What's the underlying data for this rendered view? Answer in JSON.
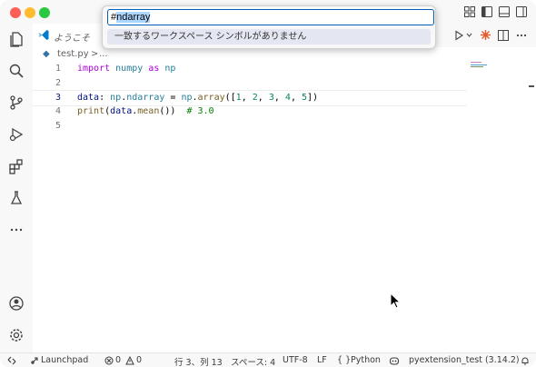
{
  "window": {
    "title_icons": [
      "layout-icon",
      "toggle-primary-sidebar-icon",
      "toggle-panel-icon",
      "toggle-secondary-sidebar-icon"
    ]
  },
  "tab": {
    "label": "ようこそ"
  },
  "breadcrumb": {
    "file": "test.py",
    "separator": ">",
    "more": "..."
  },
  "quick_input": {
    "value_prefix": "#",
    "value_selected": "ndarray",
    "no_results": "一致するワークスペース シンボルがありません"
  },
  "editor": {
    "lines": [
      {
        "num": "1"
      },
      {
        "num": "2"
      },
      {
        "num": "3"
      },
      {
        "num": "4"
      },
      {
        "num": "5"
      }
    ],
    "tokens": {
      "l1_import": "import",
      "l1_numpy": "numpy",
      "l1_as": "as",
      "l1_np": "np",
      "l3_data": "data",
      "l3_colon": ": ",
      "l3_np": "np",
      "l3_dot1": ".",
      "l3_ndarray": "ndarray",
      "l3_eq": " = ",
      "l3_np2": "np",
      "l3_dot2": ".",
      "l3_array": "array",
      "l3_open": "([",
      "l3_n1": "1",
      "l3_c1": ", ",
      "l3_n2": "2",
      "l3_c2": ", ",
      "l3_n3": "3",
      "l3_c3": ", ",
      "l3_n4": "4",
      "l3_c4": ", ",
      "l3_n5": "5",
      "l3_close": "])",
      "l4_print": "print",
      "l4_open": "(",
      "l4_data": "data",
      "l4_dot": ".",
      "l4_mean": "mean",
      "l4_close": "())",
      "l4_cmt": "  # 3.0"
    }
  },
  "status_bar": {
    "launchpad": "Launchpad",
    "errors": "0",
    "warnings": "0",
    "position": "行 3、列 13",
    "spaces": "スペース: 4",
    "encoding": "UTF-8",
    "eol": "LF",
    "language_braces": "{ }",
    "language": "Python",
    "environment": "pyextension_test (3.14.2)"
  },
  "colors": {
    "accent": "#005fb8",
    "keyword": "#af00db",
    "number": "#098658",
    "comment": "#008000"
  }
}
